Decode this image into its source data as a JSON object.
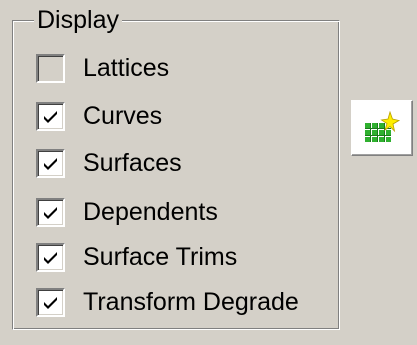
{
  "display_group": {
    "title": "Display",
    "items": [
      {
        "label": "Lattices",
        "checked": false,
        "enabled": false
      },
      {
        "label": "Curves",
        "checked": true,
        "enabled": true
      },
      {
        "label": "Surfaces",
        "checked": true,
        "enabled": true
      },
      {
        "label": "Dependents",
        "checked": true,
        "enabled": true
      },
      {
        "label": "Surface Trims",
        "checked": true,
        "enabled": true
      },
      {
        "label": "Transform Degrade",
        "checked": true,
        "enabled": true
      }
    ]
  },
  "side_button": {
    "icon": "nurbs-surface-sparkle-icon"
  },
  "colors": {
    "panel": "#d4d0c8",
    "check": "#000000",
    "icon_green": "#2fb02f",
    "icon_yellow": "#ffee00"
  }
}
